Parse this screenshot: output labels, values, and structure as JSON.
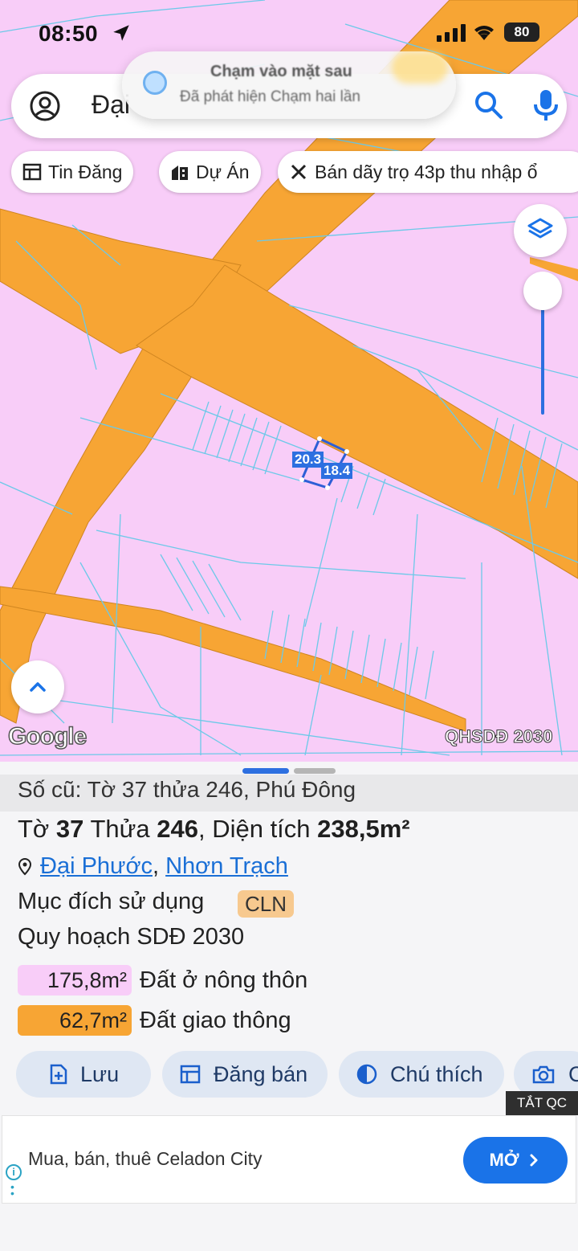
{
  "status_bar": {
    "time": "08:50",
    "battery": "80"
  },
  "search": {
    "query": "Đại"
  },
  "toast": {
    "title": "Chạm vào mặt sau",
    "subtitle": "Đã phát hiện Chạm hai lần"
  },
  "chips": [
    {
      "label": "Tin Đăng",
      "icon": "listing-icon"
    },
    {
      "label": "Dự Án",
      "icon": "building-icon"
    },
    {
      "label": "Bán dãy trọ 43p thu nhập ổ",
      "icon": "tools-icon"
    }
  ],
  "map": {
    "parcel_dims": [
      "20.3",
      "18.4"
    ],
    "provider_logo": "Google",
    "plan_label": "QHSDĐ 2030"
  },
  "sheet": {
    "old_ref": "Số cũ: Tờ 37 thửa 246, Phú Đông",
    "title": {
      "to_label": "Tờ",
      "to": "37",
      "thua_label": "Thửa",
      "thua": "246",
      "area_label": ", Diện tích",
      "area": "238,5m²"
    },
    "location": {
      "ward": "Đại Phước",
      "sep": ",",
      "district": "Nhơn Trạch"
    },
    "purpose_label": "Mục đích sử dụng",
    "purpose_code": "CLN",
    "plan_label": "Quy hoạch SDĐ 2030",
    "zones": [
      {
        "area": "175,8m²",
        "label": "Đất ở nông thôn",
        "color": "#f8cdf8"
      },
      {
        "area": "62,7m²",
        "label": "Đất giao thông",
        "color": "#f7a534"
      }
    ],
    "actions": [
      {
        "label": "Lưu",
        "icon": "save-icon"
      },
      {
        "label": "Đăng bán",
        "icon": "post-icon"
      },
      {
        "label": "Chú thích",
        "icon": "legend-icon"
      },
      {
        "label": "C",
        "icon": "camera-icon"
      }
    ]
  },
  "ad": {
    "close_label": "TẮT QC",
    "text": "Mua, bán, thuê Celadon City",
    "open_label": "MỞ"
  }
}
